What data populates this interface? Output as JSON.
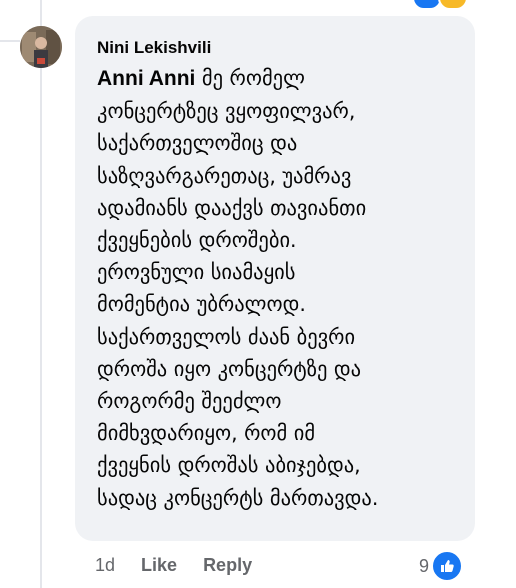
{
  "comment": {
    "author": "Nini Lekishvili",
    "mention": "Anni Anni",
    "text": " მე რომელ\nკონცერტზეც ვყოფილვარ,\nსაქართველოშიც და\nსაზღვარგარეთაც, უამრავ\nადამიანს დააქვს თავიანთი\nქვეყნების დროშები.\nეროვნული სიამაყის\nმომენტია უბრალოდ.\nსაქართველოს ძაან ბევრი\nდროშა იყო კონცერტზე და\nროგორმე შეეძლო\nმიმხვდარიყო, რომ იმ\nქვეყნის დროშას აბიჯებდა,\nსადაც კონცერტს მართავდა.",
    "time": "1d",
    "like_label": "Like",
    "reply_label": "Reply",
    "reaction_count": "9",
    "reaction_icon": "like-thumb-icon"
  },
  "colors": {
    "bubble": "#f0f2f5",
    "meta_text": "#65676b",
    "like_blue": "#1877f2",
    "top_reaction_blue": "#1877f2",
    "top_reaction_yellow": "#f7b928"
  }
}
